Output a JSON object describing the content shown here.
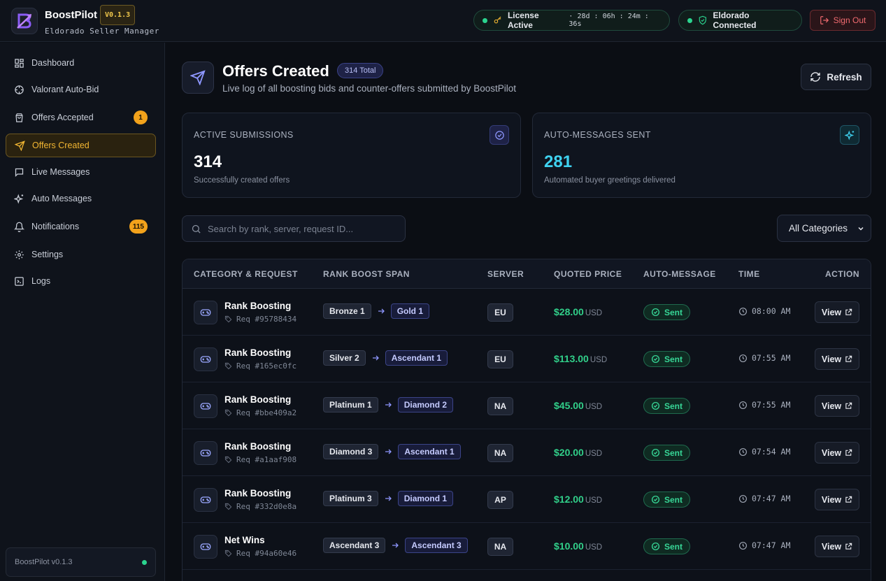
{
  "app": {
    "name": "BoostPilot",
    "version": "V0.1.3",
    "subtitle": "Eldorado Seller Manager"
  },
  "header": {
    "license_label": "License Active",
    "license_timer": "· 28d : 06h : 24m : 36s",
    "connection_label": "Eldorado Connected",
    "sign_out_label": "Sign Out"
  },
  "sidebar": {
    "items": [
      {
        "label": "Dashboard",
        "icon": "grid-icon"
      },
      {
        "label": "Valorant Auto-Bid",
        "icon": "crosshair-icon"
      },
      {
        "label": "Offers Accepted",
        "icon": "shopping-bag-icon",
        "badge": "1"
      },
      {
        "label": "Offers Created",
        "icon": "send-icon",
        "active": true
      },
      {
        "label": "Live Messages",
        "icon": "message-icon"
      },
      {
        "label": "Auto Messages",
        "icon": "sparkles-icon"
      },
      {
        "label": "Notifications",
        "icon": "bell-icon",
        "badge": "115"
      },
      {
        "label": "Settings",
        "icon": "gear-icon"
      },
      {
        "label": "Logs",
        "icon": "terminal-icon"
      }
    ],
    "footer_label": "BoostPilot v0.1.3"
  },
  "page": {
    "title": "Offers Created",
    "total_badge": "314 Total",
    "subtitle": "Live log of all boosting bids and counter-offers submitted by BoostPilot",
    "refresh_label": "Refresh"
  },
  "stats": [
    {
      "label": "ACTIVE SUBMISSIONS",
      "value": "314",
      "desc": "Successfully created offers",
      "icon": "check-circle-icon"
    },
    {
      "label": "AUTO-MESSAGES SENT",
      "value": "281",
      "desc": "Automated buyer greetings delivered",
      "icon": "sparkles-icon"
    }
  ],
  "filters": {
    "search_placeholder": "Search by rank, server, request ID...",
    "category_selected": "All Categories"
  },
  "table": {
    "headers": [
      "CATEGORY & REQUEST",
      "RANK BOOST SPAN",
      "SERVER",
      "QUOTED PRICE",
      "AUTO-MESSAGE",
      "TIME",
      "ACTION"
    ],
    "rows": [
      {
        "category": "Rank Boosting",
        "req": "Req #95788434",
        "from": "Bronze 1",
        "to": "Gold 1",
        "server": "EU",
        "price": "$28.00",
        "currency": "USD",
        "status": "Sent",
        "time": "08:00 AM",
        "action": "View"
      },
      {
        "category": "Rank Boosting",
        "req": "Req #165ec0fc",
        "from": "Silver 2",
        "to": "Ascendant 1",
        "server": "EU",
        "price": "$113.00",
        "currency": "USD",
        "status": "Sent",
        "time": "07:55 AM",
        "action": "View"
      },
      {
        "category": "Rank Boosting",
        "req": "Req #bbe409a2",
        "from": "Platinum 1",
        "to": "Diamond 2",
        "server": "NA",
        "price": "$45.00",
        "currency": "USD",
        "status": "Sent",
        "time": "07:55 AM",
        "action": "View"
      },
      {
        "category": "Rank Boosting",
        "req": "Req #a1aaf908",
        "from": "Diamond 3",
        "to": "Ascendant 1",
        "server": "NA",
        "price": "$20.00",
        "currency": "USD",
        "status": "Sent",
        "time": "07:54 AM",
        "action": "View"
      },
      {
        "category": "Rank Boosting",
        "req": "Req #332d0e8a",
        "from": "Platinum 3",
        "to": "Diamond 1",
        "server": "AP",
        "price": "$12.00",
        "currency": "USD",
        "status": "Sent",
        "time": "07:47 AM",
        "action": "View"
      },
      {
        "category": "Net Wins",
        "req": "Req #94a60e46",
        "from": "Ascendant 3",
        "to": "Ascendant 3",
        "server": "NA",
        "price": "$10.00",
        "currency": "USD",
        "status": "Sent",
        "time": "07:47 AM",
        "action": "View"
      }
    ]
  },
  "colors": {
    "accent": "#f2b632",
    "success": "#31d08a",
    "cyan": "#3fd2f0",
    "danger": "#f06a6f",
    "indigo": "#7a86ff"
  }
}
